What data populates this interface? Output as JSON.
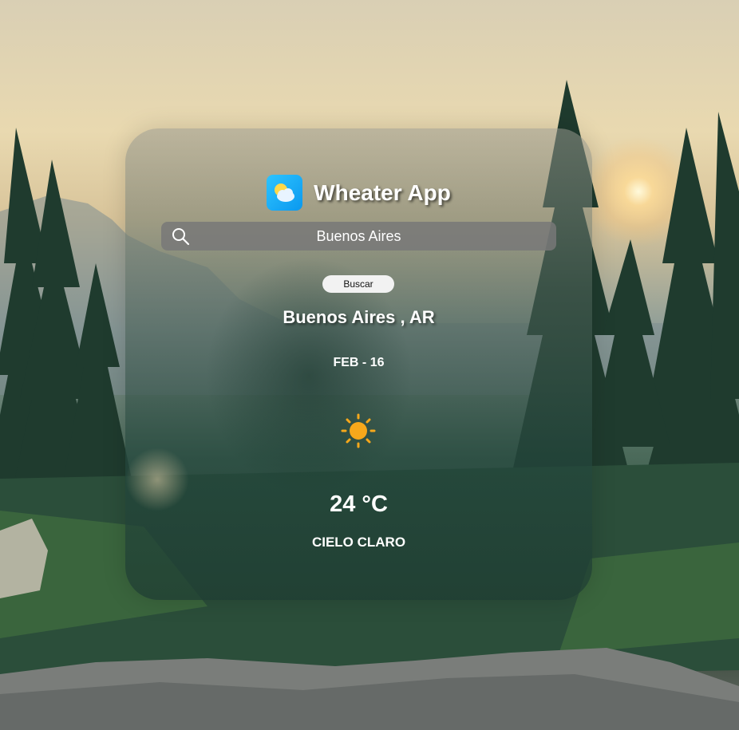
{
  "app": {
    "title": "Wheater App",
    "logo_icon": "partly-cloudy-icon"
  },
  "search": {
    "value": "Buenos Aires",
    "icon": "search-icon",
    "button_label": "Buscar"
  },
  "weather": {
    "location": "Buenos Aires , AR",
    "date": "FEB - 16",
    "icon": "sun-icon",
    "temperature": "24 °C",
    "condition": "CIELO CLARO"
  },
  "colors": {
    "accent_logo": "#0a98ef",
    "sun": "#f7a81b",
    "text": "#ffffff"
  }
}
